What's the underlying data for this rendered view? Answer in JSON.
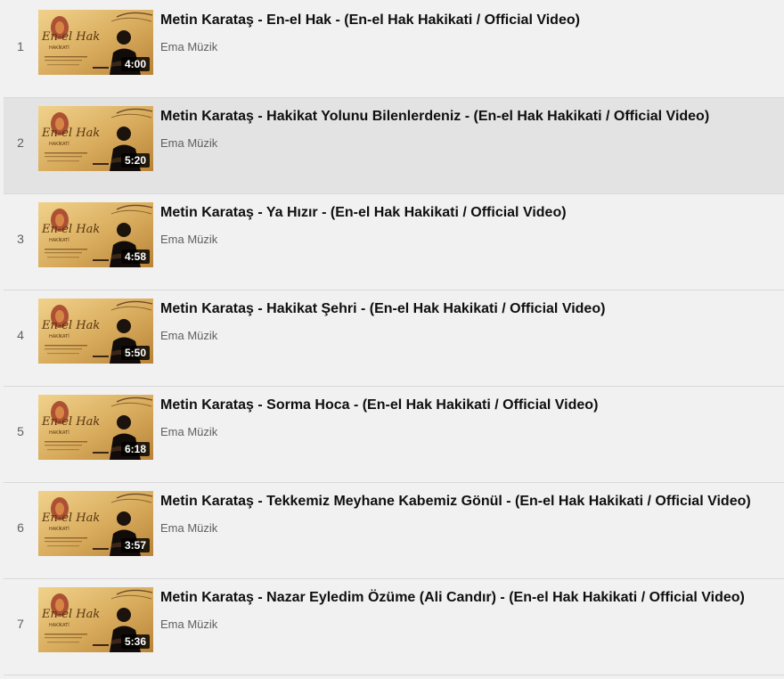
{
  "playlist": {
    "items": [
      {
        "index": "1",
        "title": "Metin Karataş - En-el Hak - (En-el Hak Hakikati / Official Video)",
        "channel": "Ema Müzik",
        "duration": "4:00",
        "active": false
      },
      {
        "index": "2",
        "title": "Metin Karataş - Hakikat Yolunu Bilenlerdeniz - (En-el Hak Hakikati / Official Video)",
        "channel": "Ema Müzik",
        "duration": "5:20",
        "active": true
      },
      {
        "index": "3",
        "title": "Metin Karataş - Ya Hızır - (En-el Hak Hakikati / Official Video)",
        "channel": "Ema Müzik",
        "duration": "4:58",
        "active": false
      },
      {
        "index": "4",
        "title": "Metin Karataş - Hakikat Şehri - (En-el Hak Hakikati / Official Video)",
        "channel": "Ema Müzik",
        "duration": "5:50",
        "active": false
      },
      {
        "index": "5",
        "title": "Metin Karataş - Sorma Hoca - (En-el Hak Hakikati / Official Video)",
        "channel": "Ema Müzik",
        "duration": "6:18",
        "active": false
      },
      {
        "index": "6",
        "title": "Metin Karataş - Tekkemiz Meyhane Kabemiz Gönül - (En-el Hak Hakikati / Official Video)",
        "channel": "Ema Müzik",
        "duration": "3:57",
        "active": false
      },
      {
        "index": "7",
        "title": "Metin Karataş - Nazar Eyledim Özüme (Ali Candır) - (En-el Hak Hakikati / Official Video)",
        "channel": "Ema Müzik",
        "duration": "5:36",
        "active": false
      }
    ]
  },
  "thumbnail_art": {
    "logo_main": "En-el Hak",
    "logo_sub": "HAKİKATİ",
    "signature": "Metin Karataş"
  },
  "colors": {
    "background": "#f1f1f1",
    "active_row": "#e3e3e3",
    "title_text": "#0f0f0f",
    "secondary_text": "#606060",
    "thumbnail_gold": "#d9b56b"
  }
}
